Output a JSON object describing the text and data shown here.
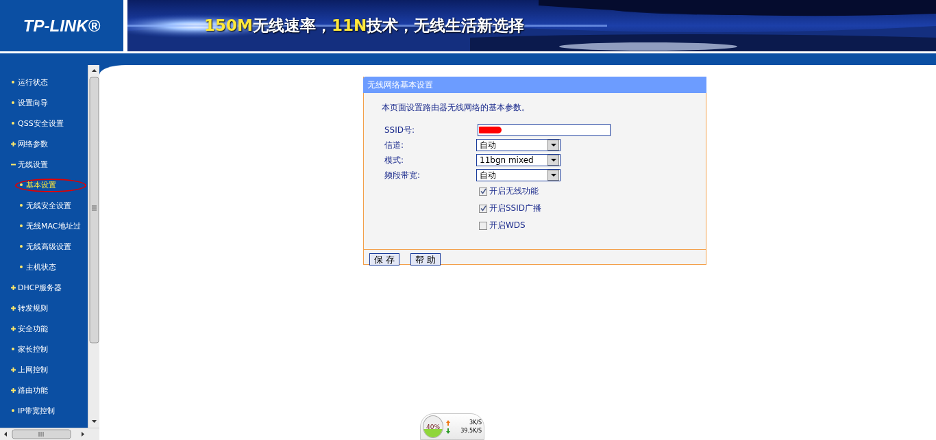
{
  "header": {
    "logo": "TP-LINK®",
    "slogan": [
      {
        "text": "150M",
        "highlight": true
      },
      {
        "text": "无线速率，",
        "highlight": false
      },
      {
        "text": "11N",
        "highlight": true
      },
      {
        "text": "技术，无线生活新选择",
        "highlight": false
      }
    ]
  },
  "sidebar": {
    "items": [
      {
        "label": "运行状态",
        "kind": "bullet",
        "selected": false
      },
      {
        "label": "设置向导",
        "kind": "bullet",
        "selected": false
      },
      {
        "label": "QSS安全设置",
        "kind": "bullet",
        "selected": false
      },
      {
        "label": "网络参数",
        "kind": "plus",
        "selected": false
      },
      {
        "label": "无线设置",
        "kind": "minus",
        "selected": false,
        "children": [
          {
            "label": "基本设置",
            "kind": "bullet",
            "selected": true,
            "circled": true
          },
          {
            "label": "无线安全设置",
            "kind": "bullet",
            "selected": false
          },
          {
            "label": "无线MAC地址过",
            "kind": "bullet",
            "selected": false
          },
          {
            "label": "无线高级设置",
            "kind": "bullet",
            "selected": false
          },
          {
            "label": "主机状态",
            "kind": "bullet",
            "selected": false
          }
        ]
      },
      {
        "label": "DHCP服务器",
        "kind": "plus",
        "selected": false
      },
      {
        "label": "转发规则",
        "kind": "plus",
        "selected": false
      },
      {
        "label": "安全功能",
        "kind": "plus",
        "selected": false
      },
      {
        "label": "家长控制",
        "kind": "bullet",
        "selected": false
      },
      {
        "label": "上网控制",
        "kind": "plus",
        "selected": false
      },
      {
        "label": "路由功能",
        "kind": "plus",
        "selected": false
      },
      {
        "label": "IP带宽控制",
        "kind": "bullet",
        "selected": false
      }
    ]
  },
  "panel": {
    "title": "无线网络基本设置",
    "description": "本页面设置路由器无线网络的基本参数。",
    "fields": [
      {
        "label": "SSID号:",
        "kind": "text",
        "redacted": true
      },
      {
        "label": "信道:",
        "kind": "select",
        "value": "自动"
      },
      {
        "label": "模式:",
        "kind": "select",
        "value": "11bgn mixed"
      },
      {
        "label": "频段带宽:",
        "kind": "select",
        "value": "自动"
      }
    ],
    "checkboxes": [
      {
        "label": "开启无线功能",
        "checked": true
      },
      {
        "label": "开启SSID广播",
        "checked": true
      },
      {
        "label": "开启WDS",
        "checked": false
      }
    ],
    "buttons": [
      "保 存",
      "帮 助"
    ]
  },
  "speed_widget": {
    "percent": "40%",
    "level": 0.4,
    "upload": "3K/S",
    "download": "39.5K/S"
  }
}
